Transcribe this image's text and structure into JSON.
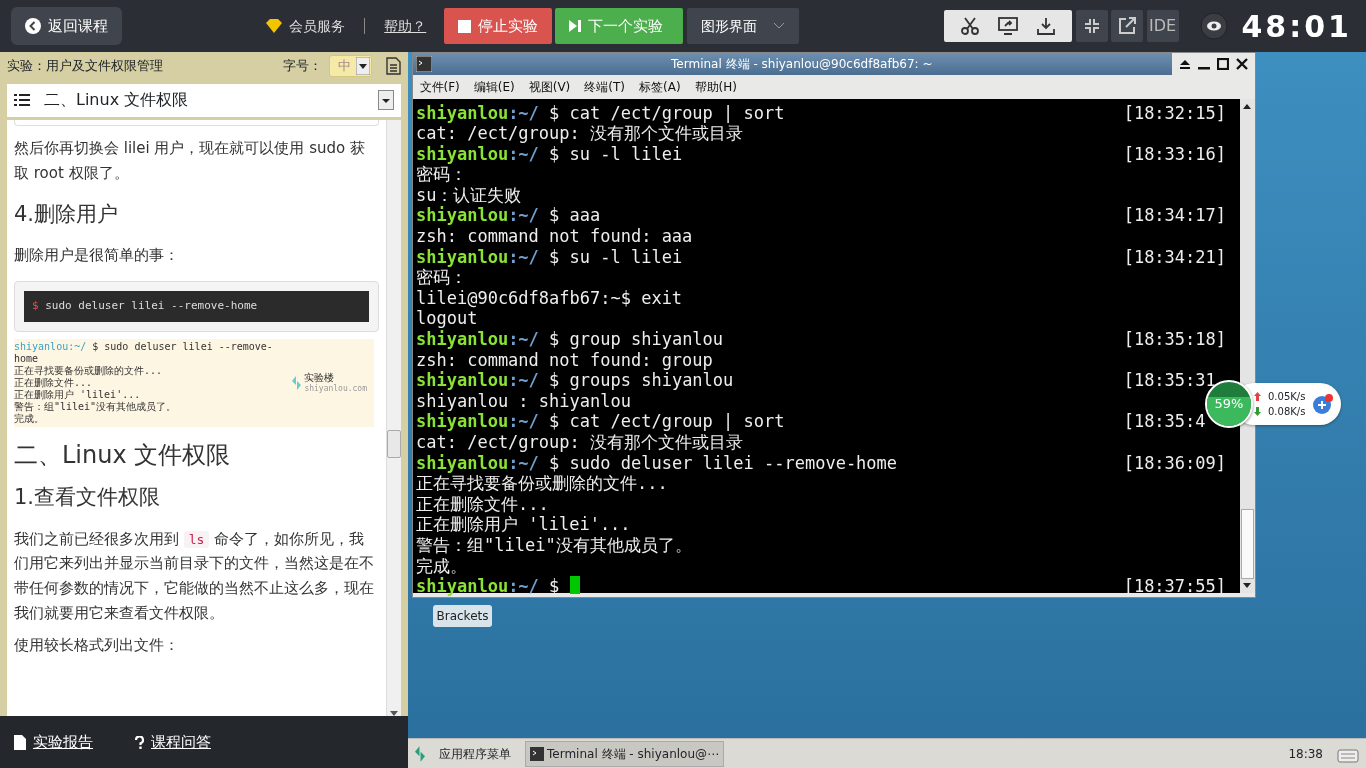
{
  "topbar": {
    "back": "返回课程",
    "vip": "会员服务",
    "help": "帮助？",
    "stop": "停止实验",
    "next": "下一个实验",
    "mode": "图形界面",
    "ide": "IDE",
    "timer": "48:01"
  },
  "sidebar": {
    "title": "实验：用户及文件权限管理",
    "font_label": "字号：",
    "font_size": "中",
    "toc": "二、Linux 文件权限",
    "content": [
      {
        "kind": "para",
        "text": "然后你再切换会 lilei 用户，现在就可以使用 sudo 获取 root 权限了。"
      },
      {
        "kind": "h3",
        "text": "4.删除用户"
      },
      {
        "kind": "para",
        "text": "删除用户是很简单的事："
      },
      {
        "kind": "code",
        "prompt": "$",
        "text": "sudo deluser lilei --remove-home"
      },
      {
        "kind": "screenshot",
        "user": "shiyanlou",
        "path": ":~/",
        "cmd": "$ sudo deluser lilei --remove-home",
        "lines": [
          "正在寻找要备份或删除的文件...",
          "正在删除文件...",
          "正在删除用户 'lilei'...",
          "警告：组\"lilei\"没有其他成员了。",
          "完成。"
        ],
        "brand": "实验楼",
        "brand_sub": "shiyanlou.com"
      },
      {
        "kind": "h2",
        "text": "二、Linux 文件权限"
      },
      {
        "kind": "h3",
        "text": "1.查看文件权限"
      },
      {
        "kind": "para_code",
        "before": "我们之前已经很多次用到",
        "code": "ls",
        "after": "命令了，如你所见，我们用它来列出并显示当前目录下的文件，当然这是在不带任何参数的情况下，它能做的当然不止这么多，现在我们就要用它来查看文件权限。"
      },
      {
        "kind": "para",
        "text": "使用较长格式列出文件："
      }
    ],
    "report": "实验报告",
    "qa": "课程问答"
  },
  "terminal": {
    "title": "Terminal 终端 - shiyanlou@90c6df8afb67: ~",
    "menu": [
      "文件(F)",
      "编辑(E)",
      "视图(V)",
      "终端(T)",
      "标签(A)",
      "帮助(H)"
    ],
    "lines": [
      {
        "kind": "prompt",
        "user": "shiyanlou",
        "path": ":~/",
        "cmd": "$ cat /ect/group | sort",
        "time": "[18:32:15]"
      },
      {
        "kind": "output",
        "text": "cat: /ect/group: 没有那个文件或目录"
      },
      {
        "kind": "prompt",
        "user": "shiyanlou",
        "path": ":~/",
        "cmd": "$ su -l lilei",
        "time": "[18:33:16]"
      },
      {
        "kind": "output",
        "text": "密码："
      },
      {
        "kind": "output",
        "text": "su：认证失败"
      },
      {
        "kind": "prompt",
        "user": "shiyanlou",
        "path": ":~/",
        "cmd": "$ aaa",
        "time": "[18:34:17]"
      },
      {
        "kind": "output",
        "text": "zsh: command not found: aaa"
      },
      {
        "kind": "prompt",
        "user": "shiyanlou",
        "path": ":~/",
        "cmd": "$ su -l lilei",
        "time": "[18:34:21]"
      },
      {
        "kind": "output",
        "text": "密码："
      },
      {
        "kind": "output",
        "text": "lilei@90c6df8afb67:~$ exit"
      },
      {
        "kind": "output",
        "text": "logout"
      },
      {
        "kind": "prompt",
        "user": "shiyanlou",
        "path": ":~/",
        "cmd": "$ group shiyanlou",
        "time": "[18:35:18]"
      },
      {
        "kind": "output",
        "text": "zsh: command not found: group"
      },
      {
        "kind": "prompt",
        "user": "shiyanlou",
        "path": ":~/",
        "cmd": "$ groups shiyanlou",
        "time": "[18:35:31"
      },
      {
        "kind": "output",
        "text": "shiyanlou : shiyanlou"
      },
      {
        "kind": "prompt",
        "user": "shiyanlou",
        "path": ":~/",
        "cmd": "$ cat /ect/group | sort",
        "time": "[18:35:4"
      },
      {
        "kind": "output",
        "text": "cat: /ect/group: 没有那个文件或目录"
      },
      {
        "kind": "prompt",
        "user": "shiyanlou",
        "path": ":~/",
        "cmd": "$ sudo deluser lilei --remove-home",
        "time": "[18:36:09]"
      },
      {
        "kind": "output",
        "text": "正在寻找要备份或删除的文件..."
      },
      {
        "kind": "output",
        "text": "正在删除文件..."
      },
      {
        "kind": "output",
        "text": "正在删除用户 'lilei'..."
      },
      {
        "kind": "output",
        "text": "警告：组\"lilei\"没有其他成员了。"
      },
      {
        "kind": "output",
        "text": "完成。"
      },
      {
        "kind": "prompt",
        "user": "shiyanlou",
        "path": ":~/",
        "cmd": "$",
        "time": "[18:37:55]",
        "cursor": true
      }
    ]
  },
  "desktop_icon": "Brackets",
  "net_widget": {
    "percent": "59%",
    "up": "0.05K/s",
    "down": "0.08K/s"
  },
  "taskbar": {
    "menu": "应用程序菜单",
    "tasks": [
      {
        "label": "Terminal 终端 - shiyanlou@⋯",
        "selected": true
      }
    ],
    "clock": "18:38"
  }
}
